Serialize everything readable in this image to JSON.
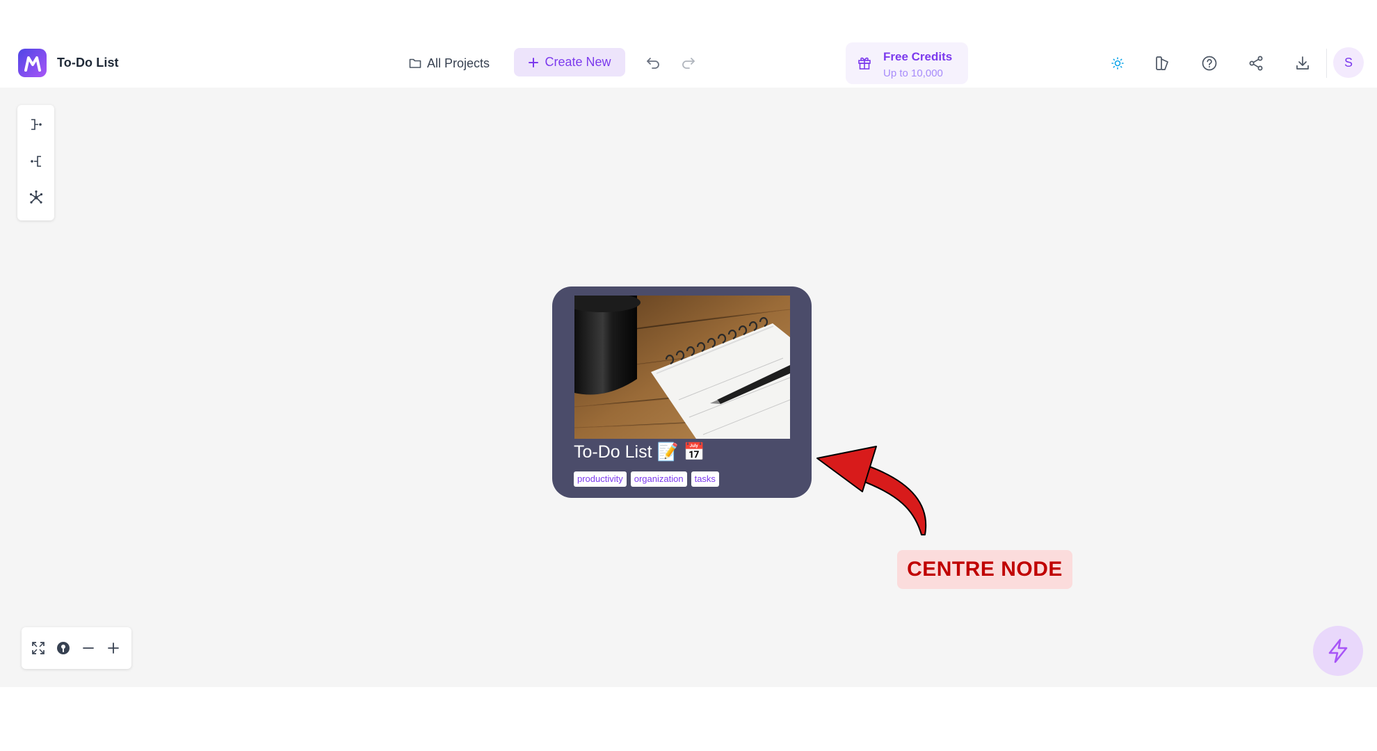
{
  "header": {
    "app_title": "To-Do List",
    "all_projects_label": "All Projects",
    "create_new_label": "Create New",
    "credits_title": "Free Credits",
    "credits_subtitle": "Up to 10,000",
    "avatar_initial": "S"
  },
  "node": {
    "title": "To-Do List 📝 📅",
    "tags": [
      "productivity",
      "organization",
      "tasks"
    ]
  },
  "annotation": {
    "label": "CENTRE NODE"
  },
  "colors": {
    "accent": "#7c3aed",
    "node_bg": "#4b4c6a",
    "canvas_bg": "#f5f5f5",
    "annotation_red": "#c00000"
  },
  "icons": {
    "header": [
      "folder-icon",
      "plus-icon",
      "undo-icon",
      "redo-icon",
      "gift-icon",
      "sun-icon",
      "layout-icon",
      "help-icon",
      "share-icon",
      "download-icon"
    ],
    "layout_toolbar": [
      "right-tree-icon",
      "left-tree-icon",
      "radial-layout-icon"
    ],
    "zoom": [
      "fit-view-icon",
      "locate-icon",
      "zoom-out-icon",
      "zoom-in-icon"
    ],
    "fab": "lightning-icon"
  }
}
